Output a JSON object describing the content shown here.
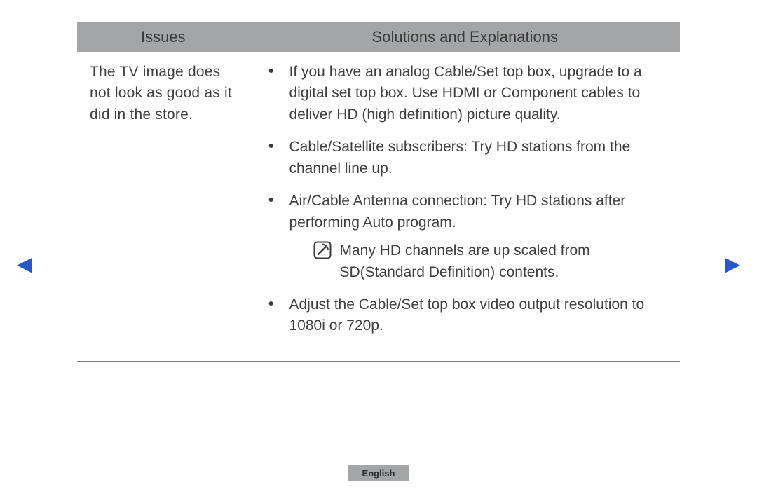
{
  "nav": {
    "prev_glyph": "◀",
    "next_glyph": "▶"
  },
  "table": {
    "headers": {
      "issues": "Issues",
      "solutions": "Solutions and Explanations"
    },
    "row": {
      "issue": "The TV image does not look as good as it did in the store.",
      "bullets": {
        "b1": "If you have an analog Cable/Set top box, upgrade to a digital set top box. Use HDMI or Component cables to deliver HD (high definition) picture quality.",
        "b2": "Cable/Satellite subscribers: Try HD stations from the channel line up.",
        "b3": "Air/Cable Antenna connection: Try HD stations after performing Auto program.",
        "b3_note": "Many HD channels are up scaled from SD(Standard Definition) contents.",
        "b4": "Adjust the Cable/Set top box video output resolution to 1080i or 720p."
      }
    }
  },
  "footer": {
    "language": "English"
  }
}
